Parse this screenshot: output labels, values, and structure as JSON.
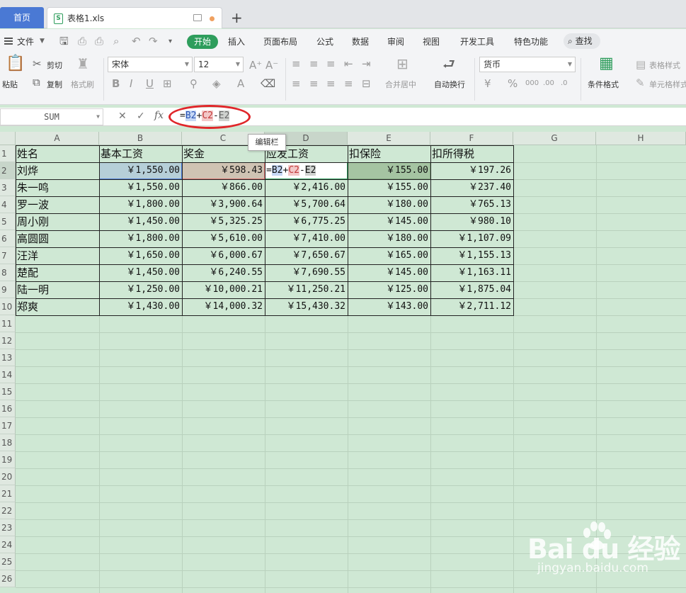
{
  "tabs": {
    "home": "首页",
    "file": "表格1.xls",
    "add": "+"
  },
  "menu": [
    "文件",
    "开始",
    "插入",
    "页面布局",
    "公式",
    "数据",
    "审阅",
    "视图",
    "开发工具",
    "特色功能",
    "查找"
  ],
  "ribbon": {
    "paste": "粘贴",
    "cut": "剪切",
    "copy": "复制",
    "format_painter": "格式刷",
    "font_name": "宋体",
    "font_size": "12",
    "merge_center": "合并居中",
    "wrap_text": "自动换行",
    "number_format": "货币",
    "cond_format": "条件格式",
    "table_style": "表格样式",
    "cell_style": "单元格样式"
  },
  "formula_bar": {
    "name_box": "SUM",
    "formula_prefix": "=",
    "ref1": "B2",
    "op1": "+",
    "ref2": "C2",
    "op2": "-",
    "ref3": "E2",
    "tooltip": "编辑栏"
  },
  "columns": [
    "A",
    "B",
    "C",
    "D",
    "E",
    "F",
    "G",
    "H"
  ],
  "rows": [
    "1",
    "2",
    "3",
    "4",
    "5",
    "6",
    "7",
    "8",
    "9",
    "10",
    "11",
    "12",
    "13",
    "14",
    "15",
    "16",
    "17",
    "18",
    "19",
    "20",
    "21",
    "22",
    "23",
    "24",
    "25",
    "26"
  ],
  "table": {
    "headers": [
      "姓名",
      "基本工资",
      "奖金",
      "应发工资",
      "扣保险",
      "扣所得税"
    ],
    "rows": [
      [
        "刘烨",
        "￥1,550.00",
        "￥598.43",
        "",
        "￥155.00",
        "￥197.26"
      ],
      [
        "朱一鸣",
        "￥1,550.00",
        "￥866.00",
        "￥2,416.00",
        "￥155.00",
        "￥237.40"
      ],
      [
        "罗一波",
        "￥1,800.00",
        "￥3,900.64",
        "￥5,700.64",
        "￥180.00",
        "￥765.13"
      ],
      [
        "周小刚",
        "￥1,450.00",
        "￥5,325.25",
        "￥6,775.25",
        "￥145.00",
        "￥980.10"
      ],
      [
        "高圆圆",
        "￥1,800.00",
        "￥5,610.00",
        "￥7,410.00",
        "￥180.00",
        "￥1,107.09"
      ],
      [
        "汪洋",
        "￥1,650.00",
        "￥6,000.67",
        "￥7,650.67",
        "￥165.00",
        "￥1,155.13"
      ],
      [
        "楚配",
        "￥1,450.00",
        "￥6,240.55",
        "￥7,690.55",
        "￥145.00",
        "￥1,163.11"
      ],
      [
        "陆一明",
        "￥1,250.00",
        "￥10,000.21",
        "￥11,250.21",
        "￥125.00",
        "￥1,875.04"
      ],
      [
        "郑爽",
        "￥1,430.00",
        "￥14,000.32",
        "￥15,430.32",
        "￥143.00",
        "￥2,711.12"
      ]
    ]
  },
  "watermark": {
    "brand": "Bai du 经验",
    "url": "jingyan.baidu.com"
  }
}
